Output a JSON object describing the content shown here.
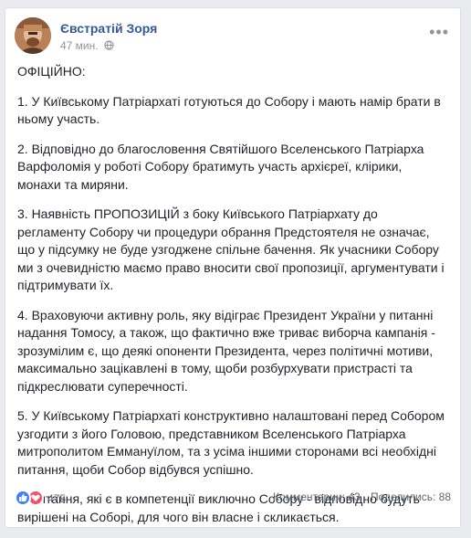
{
  "post": {
    "author": "Євстратій Зоря",
    "time": "47 мин.",
    "paragraphs": [
      "ОФІЦІЙНО:",
      "1. У Київському Патріархаті готуються до Собору і мають намір брати в ньому участь.",
      "2. Відповідно до благословення Святійшого Вселенського Патріарха Варфоломія у роботі Собору братимуть участь архієреї, клірики, монахи та миряни.",
      "3. Наявність ПРОПОЗИЦІЙ з боку Київського Патріархату до регламенту Собору чи процедури обрання Предстоятеля не означає, що у підсумку не буде узгоджене спільне бачення. Як учасники Собору ми з очевидністю маємо право вносити свої пропозиції, аргументувати і підтримувати їх.",
      "4. Враховуючи активну роль, яку відіграє Президент України у питанні надання Томосу, а також, що фактично вже триває виборча кампанія - зрозумілим є, що деякі опоненти Президента, через політичні мотиви, максимально зацікавлені в тому, щоби розбурхувати пристрасті та підкреслювати суперечності.",
      "5. У Київському Патріархаті конструктивно налаштовані перед Собором узгодити з його Головою, представником Вселенського Патріарха митрополитом Еммануїлом, та з усіма іншими сторонами всі необхідні питання, щоби Собор відбувся успішно.",
      "Ті питання, які є в компетенції виключно Собору - відповідно будуть вирішені на Соборі, для чого він власне і скликається."
    ],
    "reactions_count": "475",
    "comments_label": "Комментарии: 43",
    "shares_label": "Поделились: 88"
  },
  "icons": {
    "avatar": "avatar",
    "globe": "globe-icon",
    "more": "more-options-icon",
    "like": "like-reaction-icon",
    "love": "love-reaction-icon"
  },
  "colors": {
    "author_link": "#365899",
    "like": "#4080ff",
    "love": "#f25268"
  }
}
